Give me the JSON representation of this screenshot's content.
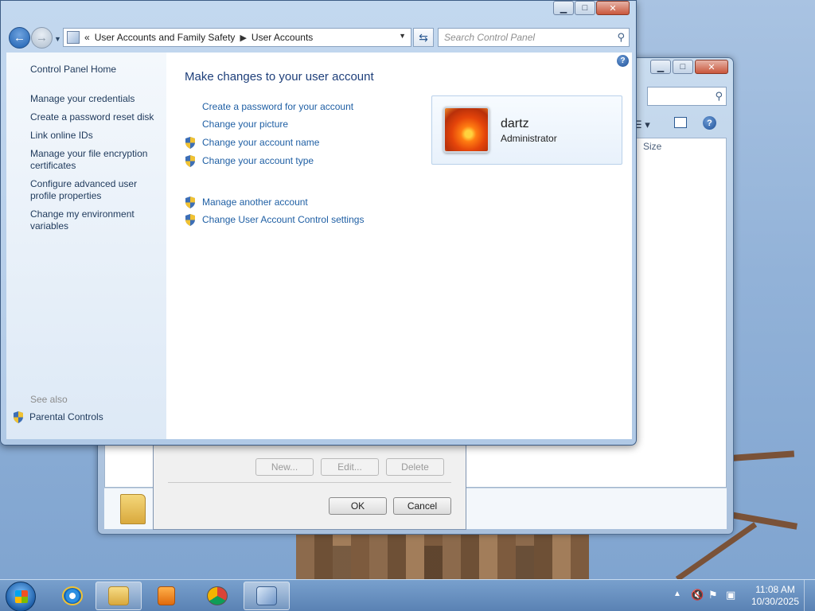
{
  "window": {
    "address": {
      "overflow": "«",
      "crumb1": "User Accounts and Family Safety",
      "crumb2": "User Accounts"
    },
    "search_placeholder": "Search Control Panel"
  },
  "sidebar": {
    "home": "Control Panel Home",
    "items": [
      "Manage your credentials",
      "Create a password reset disk",
      "Link online IDs",
      "Manage your file encryption certificates",
      "Configure advanced user profile properties",
      "Change my environment variables"
    ],
    "see_also": "See also",
    "parental_controls": "Parental Controls"
  },
  "main": {
    "title": "Make changes to your user account",
    "tasks": [
      "Create a password for your account",
      "Change your picture",
      "Change your account name",
      "Change your account type"
    ],
    "tasks2": [
      "Manage another account",
      "Change User Account Control settings"
    ],
    "account": {
      "name": "dartz",
      "role": "Administrator"
    }
  },
  "background_window": {
    "column_size": "Size"
  },
  "dialog": {
    "new_label": "New...",
    "edit_label": "Edit...",
    "delete_label": "Delete",
    "ok_label": "OK",
    "cancel_label": "Cancel"
  },
  "taskbar": {
    "time": "11:08 AM",
    "date": "10/30/2025"
  }
}
